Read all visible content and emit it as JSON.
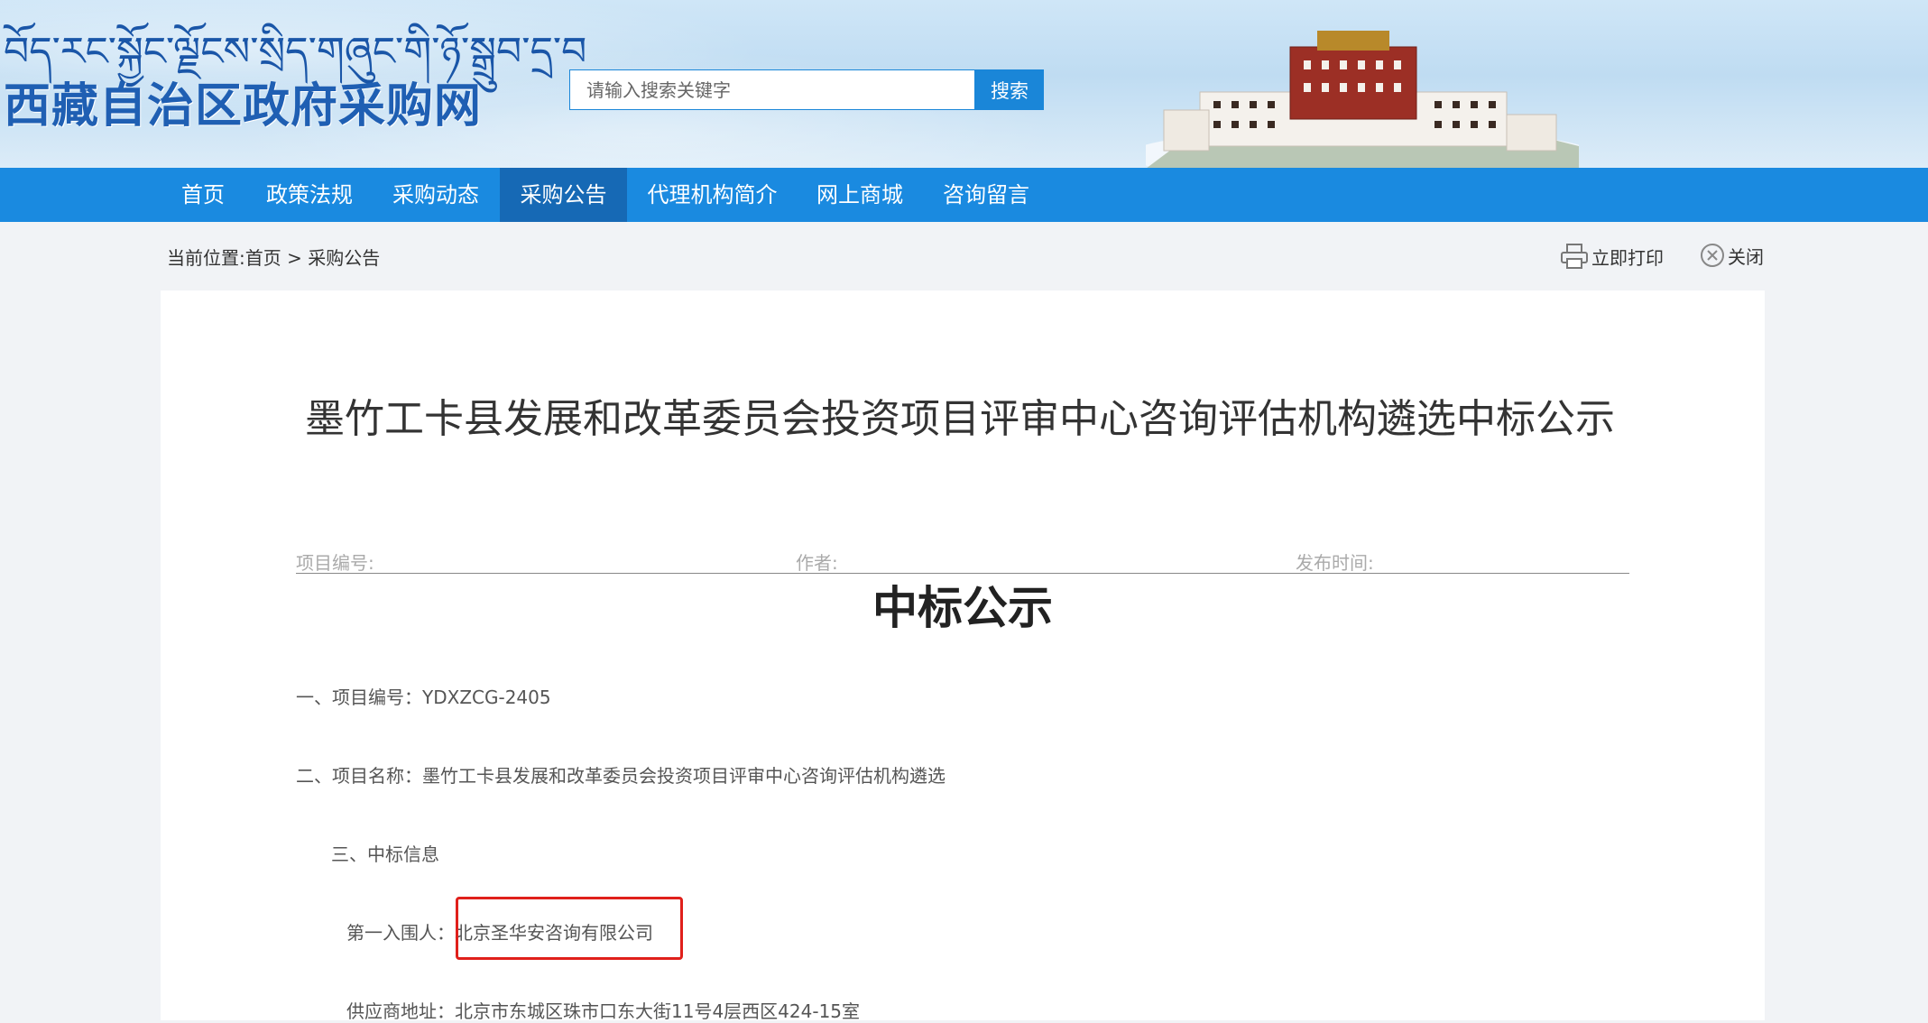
{
  "site": {
    "logo_tibetan": "བོད་རང་སྐྱོང་ལྗོངས་སྲིད་གཞུང་གི་ཉོ་སྒྲུབ་དྲ་བ",
    "logo_cn": "西藏自治区政府采购网"
  },
  "search": {
    "placeholder": "请输入搜索关键字",
    "button_label": "搜索"
  },
  "nav": {
    "items": [
      "首页",
      "政策法规",
      "采购动态",
      "采购公告",
      "代理机构简介",
      "网上商城",
      "咨询留言"
    ],
    "active": "采购公告"
  },
  "breadcrumb": "当前位置:首页 > 采购公告",
  "tools": {
    "print_label": "立即打印",
    "close_label": "关闭"
  },
  "article": {
    "title": "墨竹工卡县发展和改革委员会投资项目评审中心咨询评估机构遴选中标公示",
    "meta": {
      "project_no_label": "项目编号:",
      "author_label": "作者:",
      "publish_time_label": "发布时间:"
    },
    "notice_heading": "中标公示",
    "paragraphs": {
      "p1": "一、项目编号：YDXZCG-2405",
      "p2": "二、项目名称：墨竹工卡县发展和改革委员会投资项目评审中心咨询评估机构遴选",
      "p3": "三、中标信息",
      "winner_label": "第一入围人：",
      "winner_value": "北京圣华安咨询有限公司",
      "supplier_address": "供应商地址：北京市东城区珠市口东大街11号4层西区424-15室"
    }
  },
  "colors": {
    "nav_bg": "#1a8ae0",
    "nav_active": "#1669b5",
    "highlight_box": "#e0201b"
  }
}
